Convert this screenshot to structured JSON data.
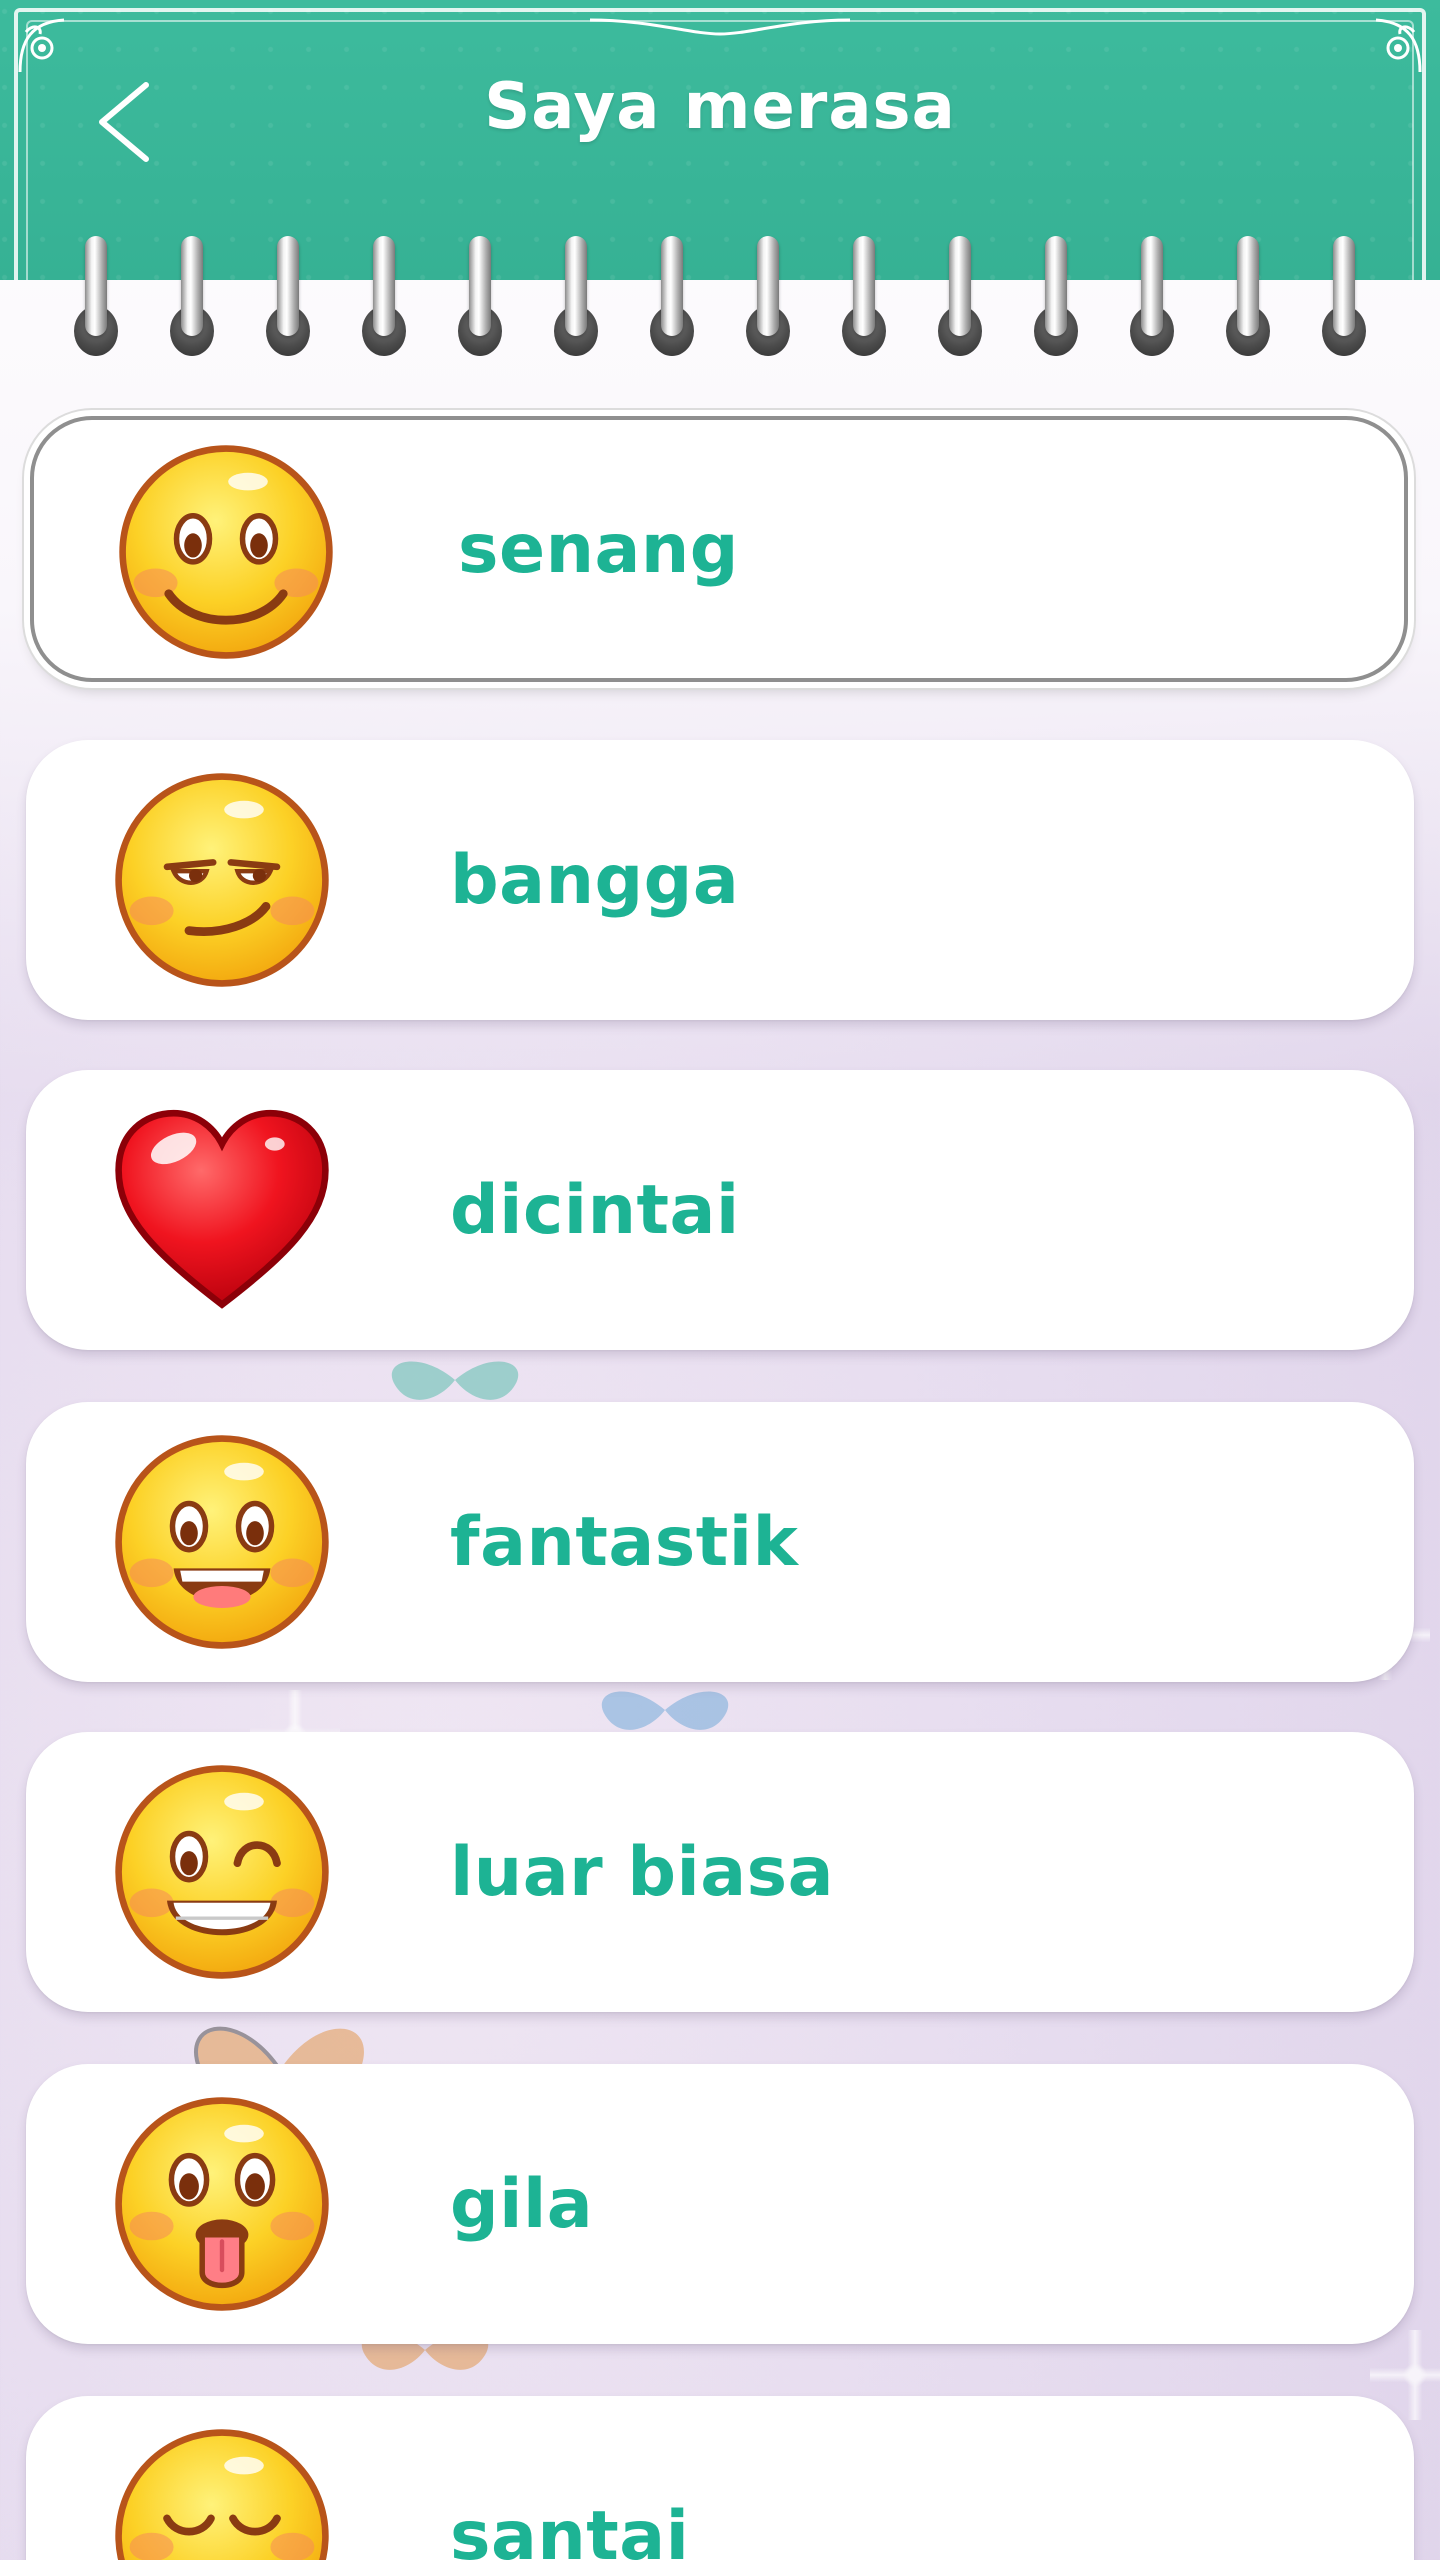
{
  "header": {
    "title": "Saya merasa",
    "back_icon": "chevron-left-icon",
    "background_color": "#3dbb9d"
  },
  "moods": [
    {
      "label": "senang",
      "icon": "smiling-face-icon",
      "selected": true
    },
    {
      "label": "bangga",
      "icon": "smirking-face-icon",
      "selected": false
    },
    {
      "label": "dicintai",
      "icon": "red-heart-icon",
      "selected": false
    },
    {
      "label": "fantastik",
      "icon": "grinning-face-icon",
      "selected": false
    },
    {
      "label": "luar biasa",
      "icon": "winking-face-icon",
      "selected": false
    },
    {
      "label": "gila",
      "icon": "tongue-out-face-icon",
      "selected": false
    },
    {
      "label": "santai",
      "icon": "relieved-face-icon",
      "selected": false
    }
  ],
  "colors": {
    "accent_text": "#1db394",
    "card_background": "#ffffff",
    "emoji_yellow": "#f9c515",
    "emoji_outline": "#b8541a",
    "heart_red": "#e8111d"
  }
}
